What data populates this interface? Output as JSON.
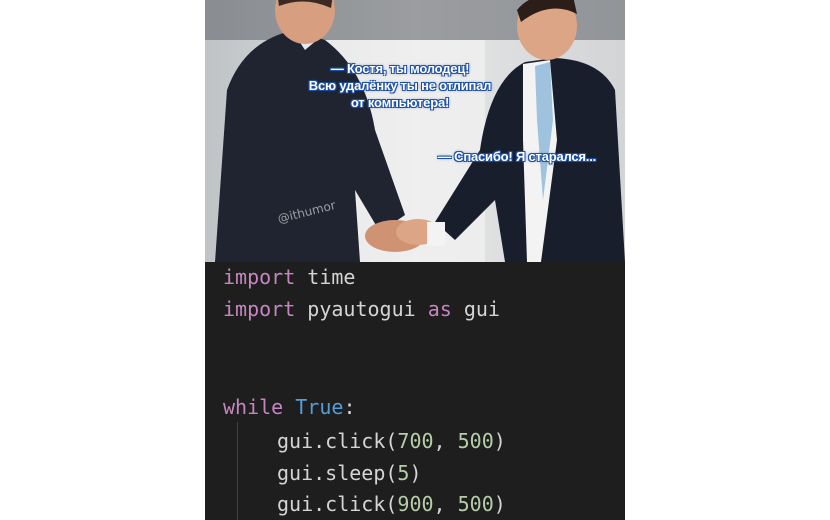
{
  "captions": {
    "boss_line1": "— Костя, ты молодец!",
    "boss_line2": "Всю удалёнку ты не отлипал",
    "boss_line3": "от компьютера!",
    "reply": "— Спасибо! Я старался..."
  },
  "watermark": "@ithumor",
  "code": {
    "line1": {
      "kw": "import",
      "rest": " time"
    },
    "line2": {
      "kw": "import",
      "mid": " pyautogui ",
      "as": "as",
      "rest": " gui"
    },
    "line3": {
      "kw": "while",
      "sp": " ",
      "bool": "True",
      "colon": ":"
    },
    "line4": {
      "pre": "gui.click(",
      "n1": "700",
      "sep": ", ",
      "n2": "500",
      "post": ")"
    },
    "line5": {
      "pre": "gui.sleep(",
      "n1": "5",
      "post": ")"
    },
    "line6": {
      "pre": "gui.click(",
      "n1": "900",
      "sep": ", ",
      "n2": "500",
      "post": ")"
    }
  },
  "colors": {
    "keyword": "#c586c0",
    "boolean": "#569cd6",
    "number": "#b5cea8",
    "text": "#d4d4d4",
    "editor_bg": "#1e1e1e",
    "caption_outline": "#1d4fa3"
  }
}
